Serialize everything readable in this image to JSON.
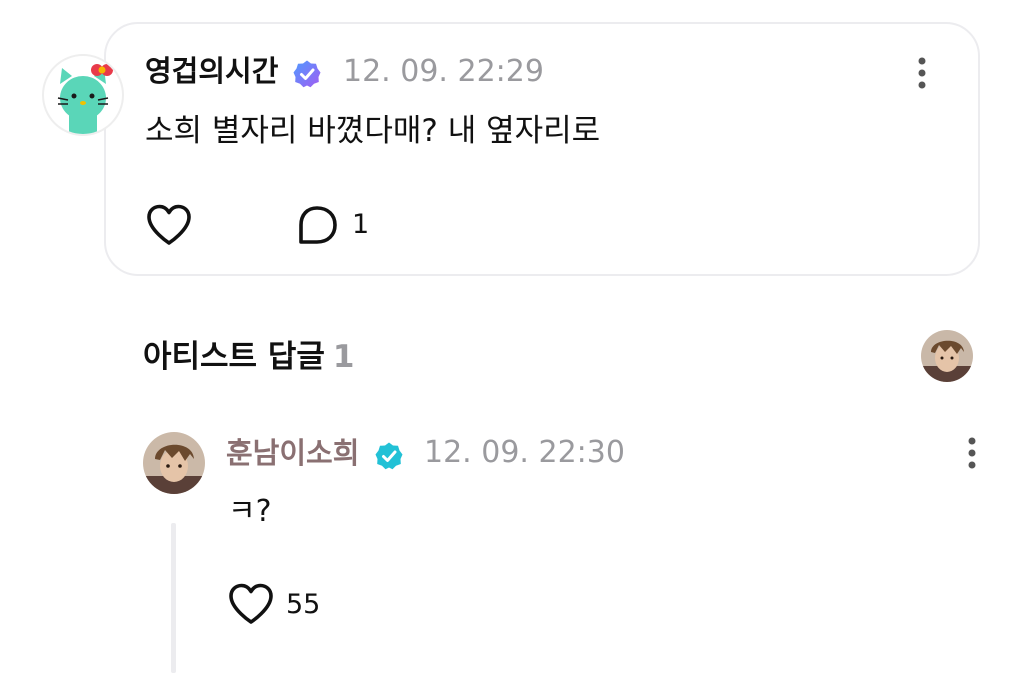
{
  "post": {
    "author": "영겁의시간",
    "date": "12. 09. 22:29",
    "text": "소희 별자리 바꼈다매? 내 옆자리로",
    "comment_count": "1"
  },
  "artist_section": {
    "title": "아티스트 답글",
    "count": "1"
  },
  "reply": {
    "author": "훈남이소희",
    "date": "12. 09. 22:30",
    "text": "ㅋ?",
    "like_count": "55"
  },
  "colors": {
    "verified_fan": "#7b6cf6",
    "verified_artist": "#22c1d6",
    "artist_name": "#8a7072",
    "meta_gray": "#9a9a9e",
    "card_border": "#ececef",
    "fan_avatar": "#5ad6b8"
  },
  "icons": [
    "more-icon",
    "verified-badge-icon",
    "heart-icon",
    "comment-icon"
  ]
}
